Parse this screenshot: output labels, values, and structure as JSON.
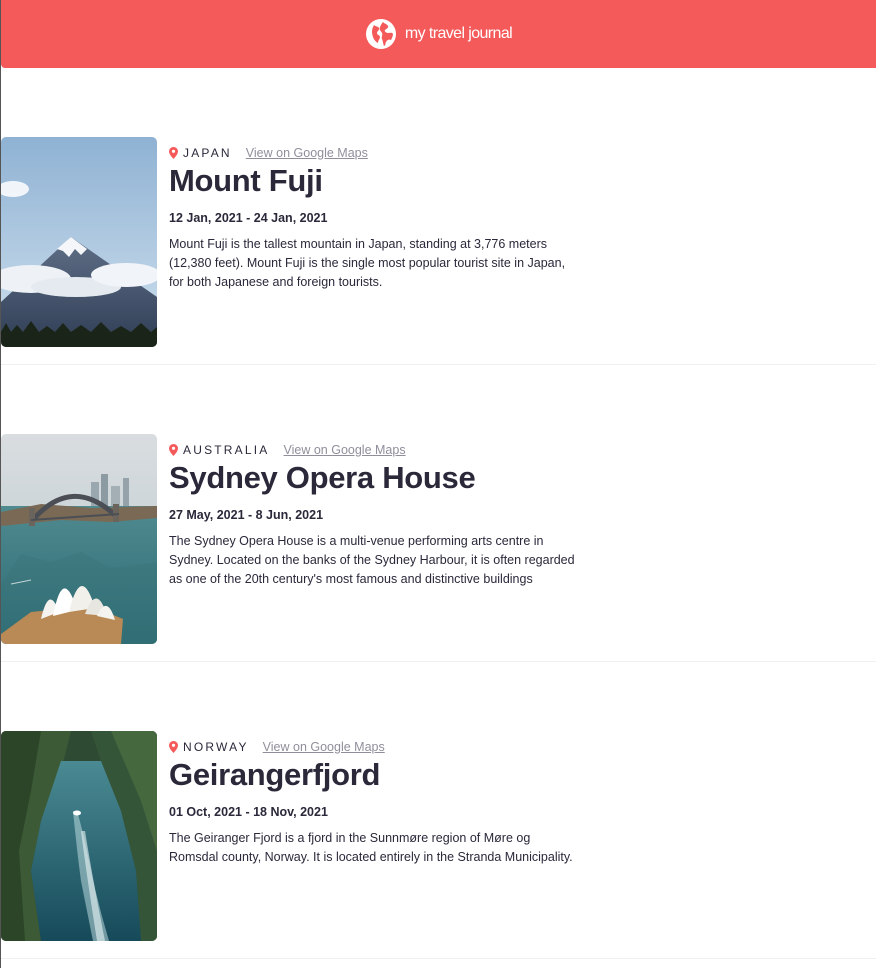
{
  "navbar": {
    "brand": "my travel journal",
    "icon": "globe-icon",
    "color": "#f55a5a"
  },
  "entries": [
    {
      "country": "JAPAN",
      "maps_link": "View on Google Maps",
      "title": "Mount Fuji",
      "dates": "12 Jan, 2021 - 24 Jan, 2021",
      "description": "Mount Fuji is the tallest mountain in Japan, standing at 3,776 meters (12,380 feet). Mount Fuji is the single most popular tourist site in Japan, for both Japanese and foreign tourists."
    },
    {
      "country": "AUSTRALIA",
      "maps_link": "View on Google Maps",
      "title": "Sydney Opera House",
      "dates": "27 May, 2021 - 8 Jun, 2021",
      "description": "The Sydney Opera House is a multi-venue performing arts centre in Sydney. Located on the banks of the Sydney Harbour, it is often regarded as one of the 20th century's most famous and distinctive buildings"
    },
    {
      "country": "NORWAY",
      "maps_link": "View on Google Maps",
      "title": "Geirangerfjord",
      "dates": "01 Oct, 2021 - 18 Nov, 2021",
      "description": "The Geiranger Fjord is a fjord in the Sunnmøre region of Møre og Romsdal county, Norway. It is located entirely in the Stranda Municipality."
    }
  ]
}
